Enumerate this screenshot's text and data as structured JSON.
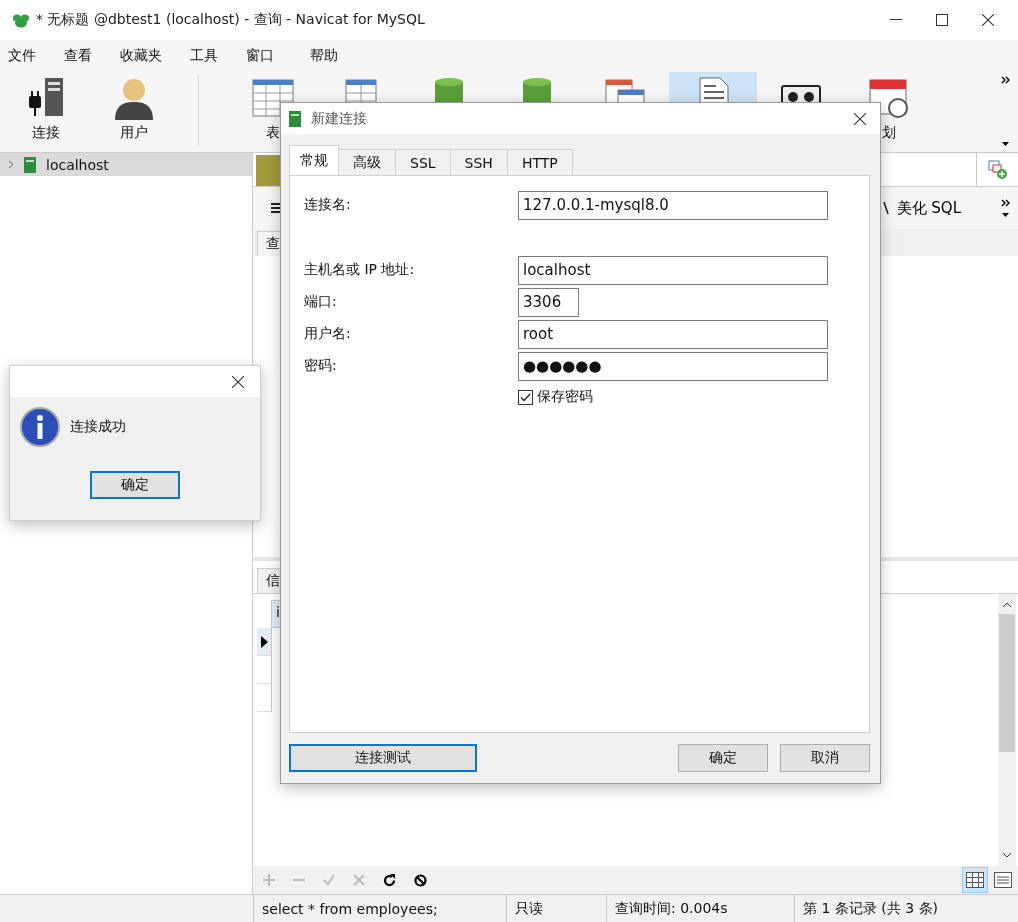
{
  "window": {
    "title": "* 无标题 @dbtest1 (localhost) - 查询 - Navicat for MySQL"
  },
  "menu": [
    "文件",
    "查看",
    "收藏夹",
    "工具",
    "窗口",
    "帮助"
  ],
  "toolbar": [
    {
      "kind": "connection",
      "label": "连接",
      "selected": false
    },
    {
      "kind": "user",
      "label": "用户",
      "selected": false
    },
    {
      "kind": "table",
      "label": "表",
      "selected": false
    },
    {
      "kind": "view",
      "selected": false
    },
    {
      "kind": "function",
      "selected": false
    },
    {
      "kind": "event",
      "selected": false
    },
    {
      "kind": "report",
      "selected": false
    },
    {
      "kind": "query",
      "selected": true
    },
    {
      "kind": "backup",
      "selected": false
    },
    {
      "kind": "schedule",
      "label": "划",
      "selected": false
    }
  ],
  "sidebar": {
    "items": [
      {
        "label": "localhost",
        "expanded": false,
        "selected": true
      }
    ]
  },
  "editor": {
    "toolbar_button": "美化 SQL",
    "tab": "查"
  },
  "results": {
    "tab": "信",
    "column": "i",
    "rows": [
      {
        "selected": true
      },
      {
        "selected": false
      },
      {
        "selected": false
      }
    ]
  },
  "status_bar": [
    "select * from employees;",
    "只读",
    "查询时间: 0.004s",
    "第 1 条记录 (共 3 条)"
  ],
  "connection_dialog": {
    "title": "新建连接",
    "tabs": [
      {
        "label": "常规",
        "selected": true
      },
      {
        "label": "高级",
        "selected": false
      },
      {
        "label": "SSL",
        "selected": false
      },
      {
        "label": "SSH",
        "selected": false
      },
      {
        "label": "HTTP",
        "selected": false
      }
    ],
    "fields": [
      {
        "label": "连接名:",
        "value": "127.0.0.1-mysql8.0",
        "kind": "text"
      },
      {
        "label": "主机名或 IP 地址:",
        "value": "localhost",
        "kind": "text"
      },
      {
        "label": "端口:",
        "value": "3306",
        "kind": "number"
      },
      {
        "label": "用户名:",
        "value": "root",
        "kind": "text"
      },
      {
        "label": "密码:",
        "value": "●●●●●●",
        "kind": "password"
      }
    ],
    "checkbox": {
      "label": "保存密码",
      "checked": true
    },
    "buttons": [
      {
        "label": "连接测试",
        "focused": true,
        "kind": "left"
      },
      {
        "label": "确定",
        "focused": false,
        "kind": "right"
      },
      {
        "label": "取消",
        "focused": false,
        "kind": "right"
      }
    ]
  },
  "message_box": {
    "message": "连接成功",
    "button": {
      "label": "确定",
      "focused": true
    }
  }
}
